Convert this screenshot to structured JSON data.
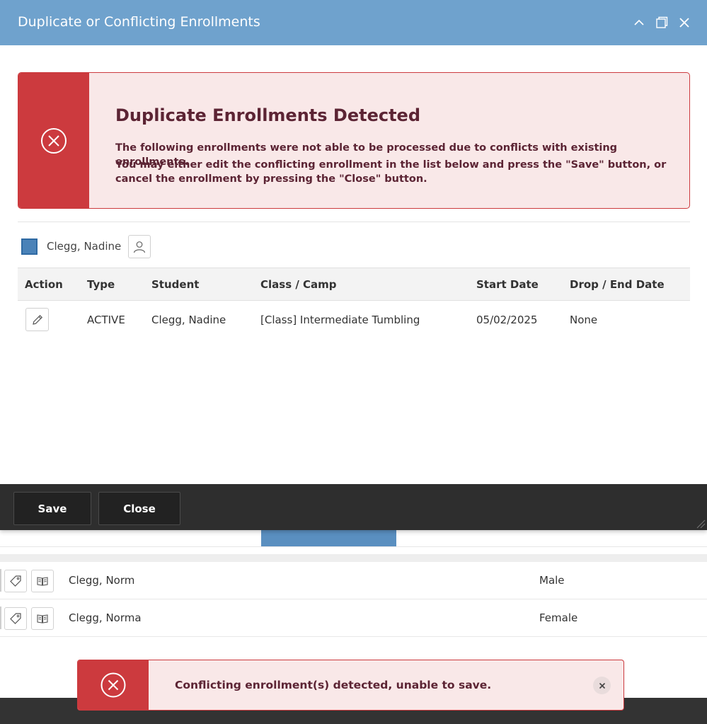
{
  "modal": {
    "title": "Duplicate or Conflicting Enrollments",
    "window_controls": [
      "chevron-up-icon",
      "maximize-icon",
      "close-icon"
    ]
  },
  "alert": {
    "icon": "error-circle-icon",
    "title": "Duplicate Enrollments Detected",
    "line1": "The following enrollments were not able to be processed due to conflicts with existing enrollments.",
    "line2": "You may either edit the conflicting enrollment in the list below and press the \"Save\" button, or cancel the enrollment by pressing the \"Close\" button."
  },
  "student": {
    "name": "Clegg, Nadine",
    "color": "#4a82b8",
    "profile_icon": "user-icon"
  },
  "grid": {
    "columns": [
      "Action",
      "Type",
      "Student",
      "Class / Camp",
      "Start Date",
      "Drop / End Date"
    ],
    "rows": [
      {
        "action_icon": "pencil-icon",
        "type": "ACTIVE",
        "student": "Clegg, Nadine",
        "class": "[Class] Intermediate Tumbling",
        "start_date": "05/02/2025",
        "end_date": "None"
      }
    ]
  },
  "footer": {
    "save_label": "Save",
    "close_label": "Close"
  },
  "background": {
    "rows": [
      {
        "name": "Clegg, Norm",
        "gender": "Male"
      },
      {
        "name": "Clegg, Norma",
        "gender": "Female"
      }
    ]
  },
  "toast": {
    "icon": "error-circle-icon",
    "message": "Conflicting enrollment(s) detected, unable to save.",
    "close_icon": "close-icon"
  },
  "colors": {
    "header": "#6fa2cd",
    "error": "#cc3a3e",
    "error_bg": "#f9e8e8",
    "error_text": "#5c2434",
    "footer": "#2e2e2e"
  }
}
